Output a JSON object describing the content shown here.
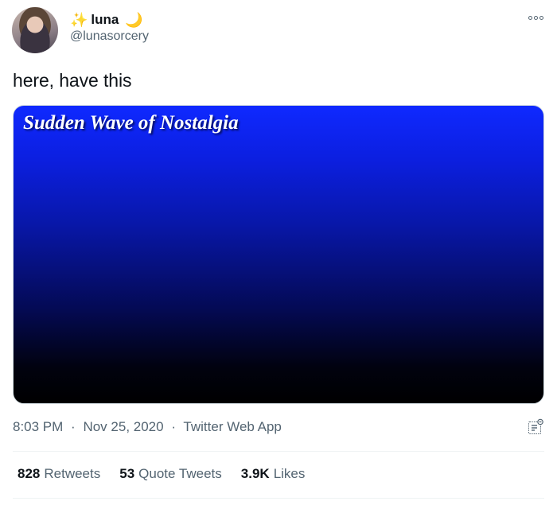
{
  "author": {
    "display_name": "luna",
    "handle": "@lunasorcery",
    "name_emoji_before": "✨",
    "name_emoji_after": "🌙"
  },
  "tweet": {
    "text": "here, have this",
    "media_caption": "Sudden Wave of Nostalgia",
    "time": "8:03 PM",
    "date": "Nov 25, 2020",
    "source": "Twitter Web App",
    "separator": "·"
  },
  "stats": {
    "retweets_count": "828",
    "retweets_label": "Retweets",
    "quotes_count": "53",
    "quotes_label": "Quote Tweets",
    "likes_count": "3.9K",
    "likes_label": "Likes"
  },
  "icons": {
    "more": "more-options-icon",
    "analytics": "analytics-icon"
  },
  "colors": {
    "text_primary": "#0f1419",
    "text_secondary": "#536471",
    "divider": "#eff3f4",
    "media_gradient_top": "#0f29ff",
    "media_gradient_bottom": "#000000"
  }
}
